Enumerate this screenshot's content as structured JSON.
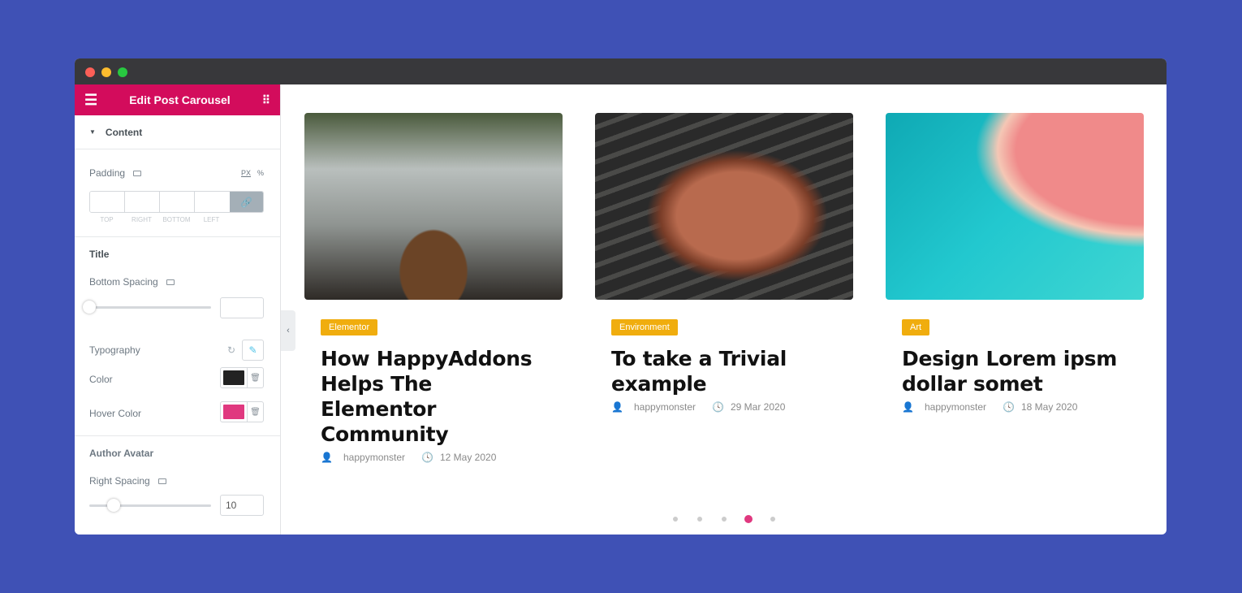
{
  "window": {
    "controls": [
      "close",
      "minimize",
      "maximize"
    ]
  },
  "sidebar": {
    "header": {
      "title": "Edit Post Carousel",
      "menu_icon": "hamburger-icon",
      "grid_icon": "grid-icon"
    },
    "section": "Content",
    "padding": {
      "label": "Padding",
      "units": [
        "PX",
        "%"
      ],
      "fields": [
        "TOP",
        "RIGHT",
        "BOTTOM",
        "LEFT"
      ]
    },
    "title_group": {
      "label": "Title",
      "bottom_spacing": "Bottom Spacing",
      "bottom_spacing_value": "",
      "bottom_spacing_slider": 0,
      "typography": "Typography",
      "color": "Color",
      "color_value": "#222222",
      "hover_color": "Hover Color",
      "hover_color_value": "#e0387f"
    },
    "avatar_group": {
      "label": "Author Avatar",
      "right_spacing": "Right Spacing",
      "right_spacing_value": "10"
    }
  },
  "posts": [
    {
      "category": "Elementor",
      "title": "How HappyAddons Helps The Elementor Community",
      "author": "happymonster",
      "date": "12 May 2020",
      "image": "cafe-table"
    },
    {
      "category": "Environment",
      "title": "To take a Trivial example",
      "author": "happymonster",
      "date": "29 Mar 2020",
      "image": "grilled-steak"
    },
    {
      "category": "Art",
      "title": "Design Lorem ipsm dollar somet",
      "author": "happymonster",
      "date": "18 May 2020",
      "image": "aerial-sea"
    }
  ],
  "pagination": {
    "count": 5,
    "active": 4
  },
  "colors": {
    "background": "#3f51b5",
    "accent": "#d30c5c",
    "badge": "#f0ad0e",
    "active_dot": "#e0387f"
  }
}
